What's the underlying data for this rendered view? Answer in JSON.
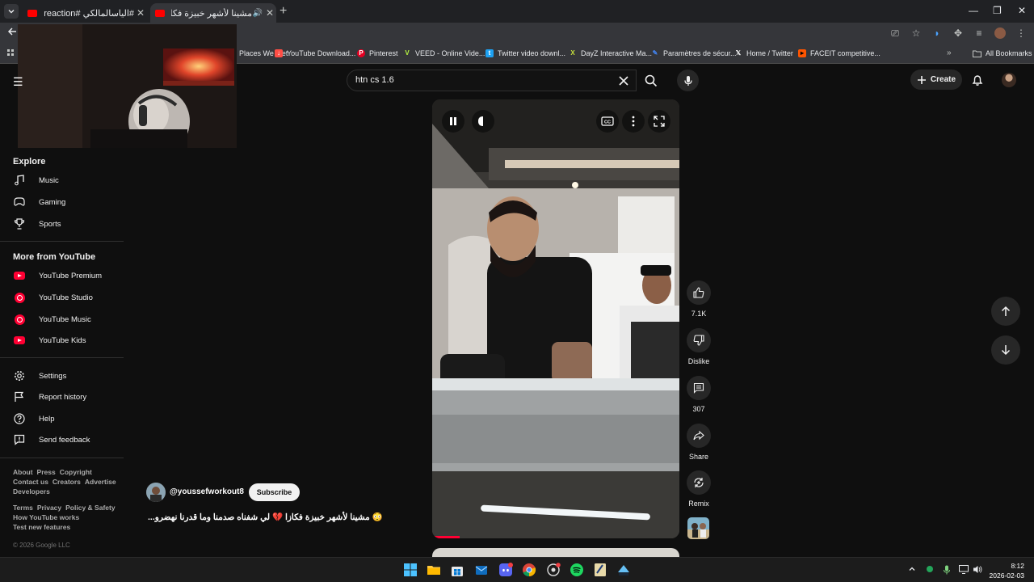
{
  "browser": {
    "tabs": [
      {
        "title": "#الياسالمالكي #edsabirireaction",
        "close": "✕"
      },
      {
        "title": "مشينا لأشهر خبيزة فكازا 💔 لي شفناه صدمنا وما قدرنا نهضرو",
        "close": "✕"
      }
    ],
    "new_tab": "+",
    "window_controls": {
      "minimize": "—",
      "maximize": "❐",
      "close": "✕"
    },
    "bookmarks": [
      {
        "label": "Places We Met",
        "color": "#e8eaed"
      },
      {
        "label": "YouTube Download...",
        "color": "#ff4e45"
      },
      {
        "label": "Pinterest",
        "color": "#e60023"
      },
      {
        "label": "VEED - Online Vide...",
        "color": "#b6f542"
      },
      {
        "label": "Twitter video downl...",
        "color": "#1da1f2"
      },
      {
        "label": "DayZ Interactive Ma...",
        "color": "#c6e03c"
      },
      {
        "label": "Paramètres de sécur...",
        "color": "#4285f4"
      },
      {
        "label": "Home / Twitter",
        "color": "#ffffff"
      },
      {
        "label": "FACEIT competitive...",
        "color": "#ff5500"
      }
    ],
    "bookmarks_more": "»",
    "all_bookmarks": "All Bookmarks"
  },
  "header": {
    "menu_icon": "☰",
    "search_value": "htn cs 1.6",
    "create_label": "Create"
  },
  "sidebar": {
    "explore_title": "Explore",
    "explore": [
      {
        "label": "Music",
        "icon": "music-note-icon"
      },
      {
        "label": "Gaming",
        "icon": "gamepad-icon"
      },
      {
        "label": "Sports",
        "icon": "trophy-icon"
      }
    ],
    "more_title": "More from YouTube",
    "more": [
      {
        "label": "YouTube Premium",
        "icon": "youtube-premium-icon"
      },
      {
        "label": "YouTube Studio",
        "icon": "youtube-studio-icon"
      },
      {
        "label": "YouTube Music",
        "icon": "youtube-music-icon"
      },
      {
        "label": "YouTube Kids",
        "icon": "youtube-kids-icon"
      }
    ],
    "settings": [
      {
        "label": "Settings",
        "icon": "gear-icon"
      },
      {
        "label": "Report history",
        "icon": "flag-icon"
      },
      {
        "label": "Help",
        "icon": "help-icon"
      },
      {
        "label": "Send feedback",
        "icon": "feedback-icon"
      }
    ],
    "footer_1": [
      "About",
      "Press",
      "Copyright"
    ],
    "footer_2": [
      "Contact us",
      "Creators",
      "Advertise"
    ],
    "footer_3": [
      "Developers"
    ],
    "footer_4": [
      "Terms",
      "Privacy",
      "Policy & Safety"
    ],
    "footer_5": [
      "How YouTube works"
    ],
    "footer_6": [
      "Test new features"
    ],
    "copyright": "© 2026 Google LLC"
  },
  "short": {
    "channel": "@youssefworkout8",
    "subscribe": "Subscribe",
    "caption": "😳 مشينا لأشهر خبيزة فكازا 💔 لي شفناه صدمنا وما قدرنا نهضرو...",
    "progress_fraction": 0.11,
    "actions": {
      "like": "7.1K",
      "dislike": "Dislike",
      "comments": "307",
      "share": "Share",
      "remix": "Remix"
    }
  },
  "taskbar": {
    "time": "8:12",
    "date": "2026-02-03"
  }
}
